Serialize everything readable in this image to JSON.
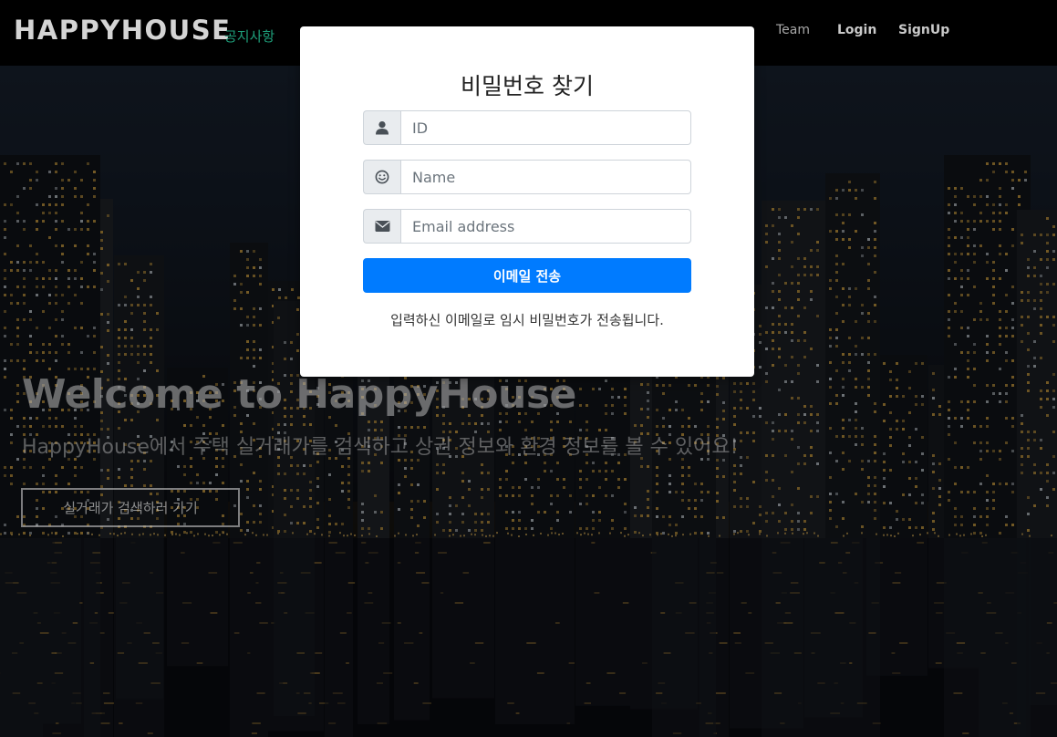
{
  "navbar": {
    "brand": "HAPPYHOUSE",
    "notice": "공지사항",
    "links": [
      "Team",
      "Login",
      "SignUp"
    ]
  },
  "hero": {
    "title": "Welcome to HappyHouse",
    "subtitle": "HappyHouse에서 주택 실거래가를 검색하고 상권 정보와 환경 정보를 볼 수 있어요!",
    "button_label": "실거래가 검색하러 가기"
  },
  "modal": {
    "title": "비밀번호 찾기",
    "fields": [
      {
        "placeholder": "ID",
        "icon": "user-icon",
        "value": ""
      },
      {
        "placeholder": "Name",
        "icon": "smile-icon",
        "value": ""
      },
      {
        "placeholder": "Email address",
        "icon": "envelope-icon",
        "value": ""
      }
    ],
    "submit_label": "이메일 전송",
    "help_text": "입력하신 이메일로 임시 비밀번호가 전송됩니다."
  },
  "colors": {
    "primary": "#007bff",
    "notice": "#1e9e7a",
    "navbar": "#000000"
  }
}
